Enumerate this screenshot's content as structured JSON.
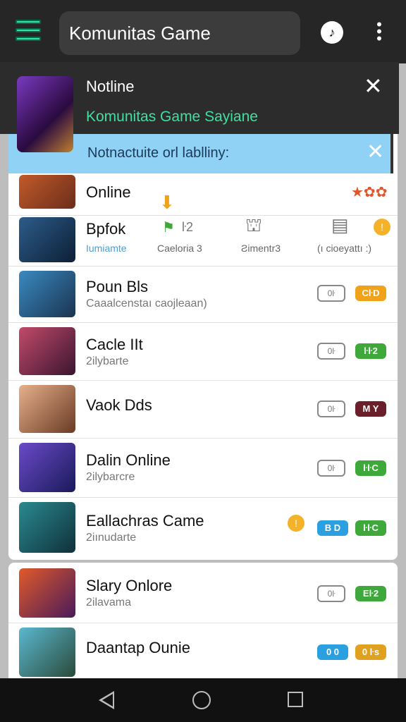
{
  "topbar": {
    "menu_icon": "hamburger-menu-icon",
    "search_value": "Komunitas Game",
    "action_icon": "music-note-icon",
    "overflow_icon": "vertical-dots-icon"
  },
  "notification": {
    "title": "Notline",
    "subtitle": "Komunitas Game Sayiane",
    "close_label": "✕"
  },
  "banner": {
    "text": "Notnactuite orl lablliny:",
    "close_label": "✕"
  },
  "rows": [
    {
      "title": "Online",
      "subtitle": "",
      "badges": [],
      "color1": "#c15a2a",
      "color2": "#6b2d1a"
    },
    {
      "title": "Bpfok",
      "subtitle": "",
      "stats": [
        "Iumiamte",
        "Caeloria 3",
        "Ƨimentr3",
        "(ı cioeyattı :)"
      ],
      "color1": "#2c5c8a",
      "color2": "#0d1f35"
    },
    {
      "title": "Poun Bls",
      "subtitle": "Caaalcenstaı caojleaan)",
      "color1": "#3a8ac0",
      "color2": "#1a3350"
    },
    {
      "title": "Cacle IIt",
      "subtitle": "2ilybarte",
      "color1": "#c24a6a",
      "color2": "#3a1530"
    },
    {
      "title": "Vaok Dds",
      "subtitle": "",
      "color1": "#e6b08a",
      "color2": "#6a3a25"
    },
    {
      "title": "Dalin Online",
      "subtitle": "2ilybarcre",
      "color1": "#6a4ac8",
      "color2": "#1a1a5a"
    },
    {
      "title": "Eallachras Came",
      "subtitle": "2iınudarte",
      "color1": "#2a8a90",
      "color2": "#10303a"
    },
    {
      "title": "Slary Onlore",
      "subtitle": "2ilavama",
      "color1": "#e05a2a",
      "color2": "#4a1a5a"
    },
    {
      "title": "Daantap Ounie",
      "subtitle": "",
      "color1": "#5ab8d0",
      "color2": "#2a4a3a"
    }
  ],
  "badges": {
    "row2": [
      "0ŀ",
      "CŀD"
    ],
    "row3": [
      "0ŀ",
      "ŀŀ2"
    ],
    "row4": [
      "0ŀ",
      "M Y"
    ],
    "row5": [
      "0ŀ",
      "ŀŀC"
    ],
    "row6": [
      "B D",
      "ŀŀC"
    ],
    "row7": [
      "0ŀ",
      "Eŀ2"
    ],
    "row8": [
      "0 0",
      "0 ŀs"
    ],
    "online_stars": "★✿✿",
    "bpfok_badge": "ŀ2"
  },
  "colors": {
    "accent_green": "#2ee6a6",
    "orange": "#f0a21a",
    "green": "#3ea83a",
    "blue": "#2aa0e0",
    "maroon": "#6a1f2a"
  },
  "navbar": {
    "back_icon": "back-triangle-icon",
    "home_icon": "home-circle-icon",
    "recents_icon": "recents-square-icon"
  }
}
